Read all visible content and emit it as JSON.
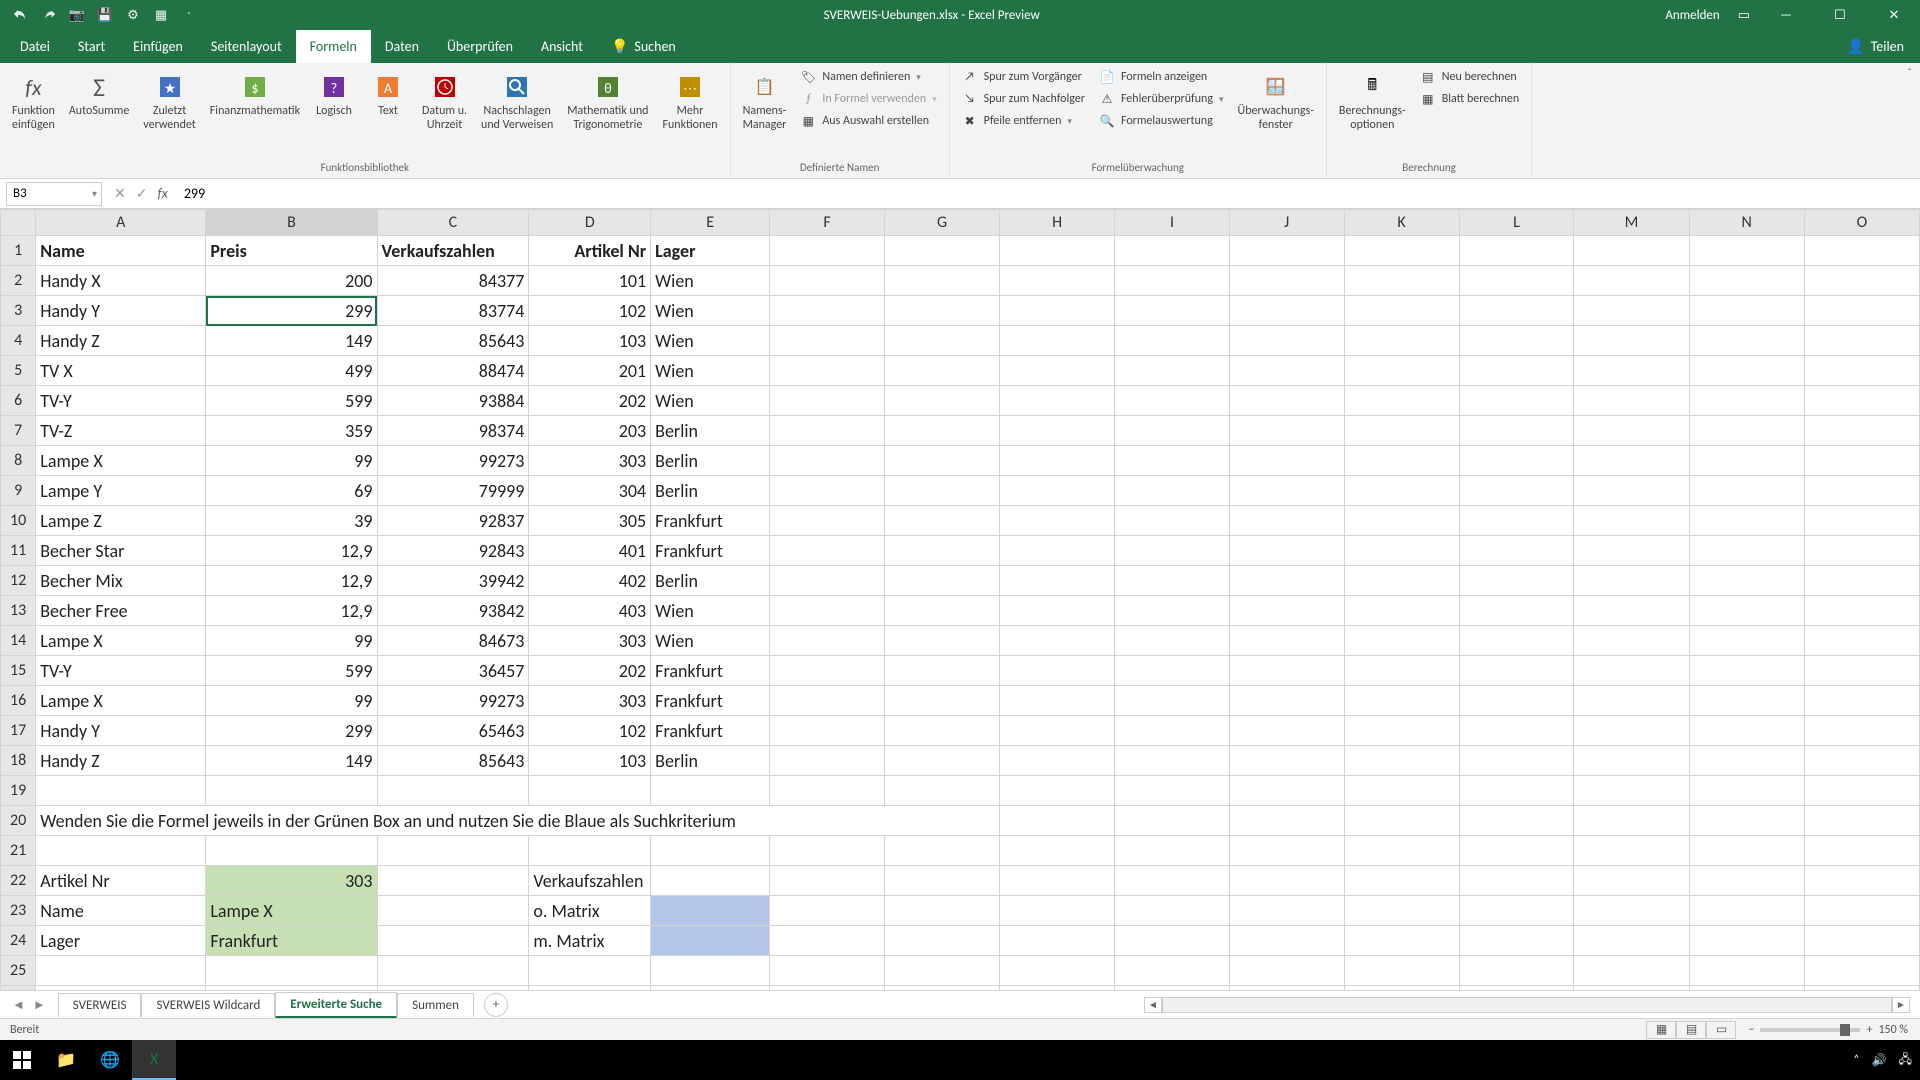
{
  "title": "SVERWEIS-Uebungen.xlsx - Excel Preview",
  "qat_signin": "Anmelden",
  "tabs": {
    "datei": "Datei",
    "start": "Start",
    "einfuegen": "Einfügen",
    "seitenlayout": "Seitenlayout",
    "formeln": "Formeln",
    "daten": "Daten",
    "ueberpruefen": "Überprüfen",
    "ansicht": "Ansicht",
    "suchen": "Suchen",
    "teilen": "Teilen"
  },
  "ribbon": {
    "g1": {
      "insert_fn": "Funktion\neinfügen",
      "autosumme": "AutoSumme",
      "zuletzt": "Zuletzt\nverwendet",
      "finanz": "Finanzmathematik",
      "logisch": "Logisch",
      "text": "Text",
      "datum": "Datum u.\nUhrzeit",
      "nachschlagen": "Nachschlagen\nund Verweisen",
      "mathe": "Mathematik und\nTrigonometrie",
      "mehr": "Mehr\nFunktionen",
      "label": "Funktionsbibliothek"
    },
    "g2": {
      "manager": "Namens-\nManager",
      "def": "Namen definieren",
      "verw": "In Formel verwenden",
      "aus": "Aus Auswahl erstellen",
      "label": "Definierte Namen"
    },
    "g3": {
      "vor": "Spur zum Vorgänger",
      "nach": "Spur zum Nachfolger",
      "pfeile": "Pfeile entfernen",
      "anzeigen": "Formeln anzeigen",
      "fehler": "Fehlerüberprüfung",
      "auswertung": "Formelauswertung",
      "fenster": "Überwachungs-\nfenster",
      "label": "Formelüberwachung"
    },
    "g4": {
      "optionen": "Berechnungs-\noptionen",
      "neu": "Neu berechnen",
      "blatt": "Blatt berechnen",
      "label": "Berechnung"
    }
  },
  "namebox": "B3",
  "formula": "299",
  "chart_data": {
    "type": "table",
    "headers": [
      "Name",
      "Preis",
      "Verkaufszahlen",
      "Artikel Nr",
      "Lager"
    ],
    "rows": [
      [
        "Handy X",
        "200",
        "84377",
        "101",
        "Wien"
      ],
      [
        "Handy Y",
        "299",
        "83774",
        "102",
        "Wien"
      ],
      [
        "Handy Z",
        "149",
        "85643",
        "103",
        "Wien"
      ],
      [
        "TV X",
        "499",
        "88474",
        "201",
        "Wien"
      ],
      [
        "TV-Y",
        "599",
        "93884",
        "202",
        "Wien"
      ],
      [
        "TV-Z",
        "359",
        "98374",
        "203",
        "Berlin"
      ],
      [
        "Lampe X",
        "99",
        "99273",
        "303",
        "Berlin"
      ],
      [
        "Lampe Y",
        "69",
        "79999",
        "304",
        "Berlin"
      ],
      [
        "Lampe Z",
        "39",
        "92837",
        "305",
        "Frankfurt"
      ],
      [
        "Becher Star",
        "12,9",
        "92843",
        "401",
        "Frankfurt"
      ],
      [
        "Becher Mix",
        "12,9",
        "39942",
        "402",
        "Berlin"
      ],
      [
        "Becher Free",
        "12,9",
        "93842",
        "403",
        "Wien"
      ],
      [
        "Lampe X",
        "99",
        "84673",
        "303",
        "Wien"
      ],
      [
        "TV-Y",
        "599",
        "36457",
        "202",
        "Frankfurt"
      ],
      [
        "Lampe X",
        "99",
        "99273",
        "303",
        "Frankfurt"
      ],
      [
        "Handy Y",
        "299",
        "65463",
        "102",
        "Frankfurt"
      ],
      [
        "Handy Z",
        "149",
        "85643",
        "103",
        "Berlin"
      ]
    ],
    "instruction": "Wenden Sie die Formel jeweils in der Grünen Box an und nutzen Sie die Blaue als Suchkriterium",
    "lookup": {
      "artikel_label": "Artikel Nr",
      "artikel_val": "303",
      "name_label": "Name",
      "name_val": "Lampe X",
      "lager_label": "Lager",
      "lager_val": "Frankfurt",
      "vk_label": "Verkaufszahlen",
      "o_matrix": "o. Matrix",
      "m_matrix": "m. Matrix"
    }
  },
  "cols": [
    "A",
    "B",
    "C",
    "D",
    "E",
    "F",
    "G",
    "H",
    "I",
    "J",
    "K",
    "L",
    "M",
    "N",
    "O"
  ],
  "sheets": {
    "s1": "SVERWEIS",
    "s2": "SVERWEIS Wildcard",
    "s3": "Erweiterte Suche",
    "s4": "Summen"
  },
  "status": {
    "ready": "Bereit",
    "zoom": "150 %"
  }
}
